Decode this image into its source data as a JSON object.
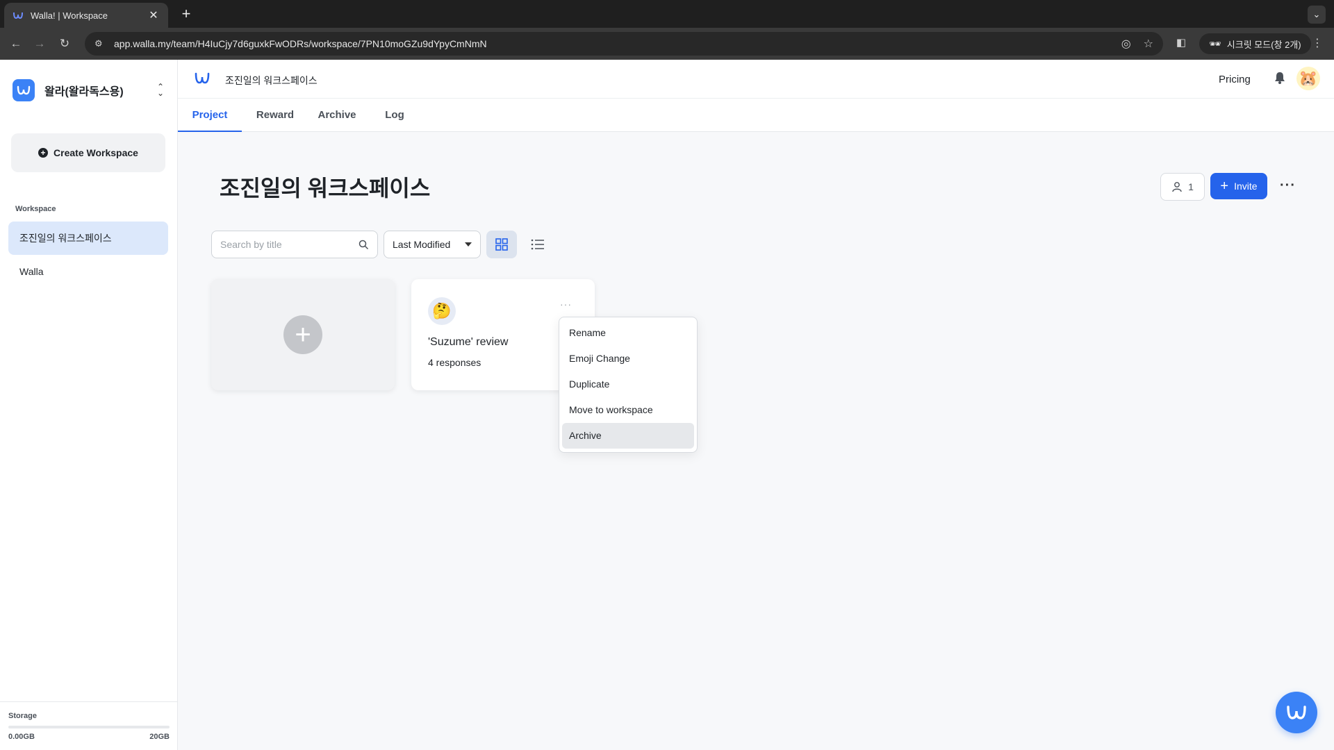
{
  "browser": {
    "tab_title": "Walla! | Workspace",
    "url": "app.walla.my/team/H4IuCjy7d6guxkFwODRs/workspace/7PN10moGZu9dYpyCmNmN",
    "incognito_label": "시크릿 모드(창 2개)"
  },
  "sidebar": {
    "team_name": "왈라(왈라독스용)",
    "create_workspace": "Create Workspace",
    "section_label": "Workspace",
    "workspaces": [
      "조진일의 워크스페이스",
      "Walla"
    ],
    "storage": {
      "label": "Storage",
      "used": "0.00GB",
      "total": "20GB",
      "used_fraction": 0
    }
  },
  "header": {
    "breadcrumb": "조진일의 워크스페이스",
    "pricing": "Pricing"
  },
  "tabs": [
    "Project",
    "Reward",
    "Archive",
    "Log"
  ],
  "page": {
    "title": "조진일의 워크스페이스",
    "member_count": "1",
    "invite": "Invite",
    "search_placeholder": "Search by title",
    "sort": "Last Modified"
  },
  "project": {
    "emoji": "🤔",
    "title": "'Suzume' review",
    "responses": "4 responses"
  },
  "context_menu": [
    "Rename",
    "Emoji Change",
    "Duplicate",
    "Move to workspace",
    "Archive"
  ],
  "colors": {
    "accent": "#2563eb",
    "brand": "#3b82f6",
    "active_bg": "#dce8fb"
  }
}
